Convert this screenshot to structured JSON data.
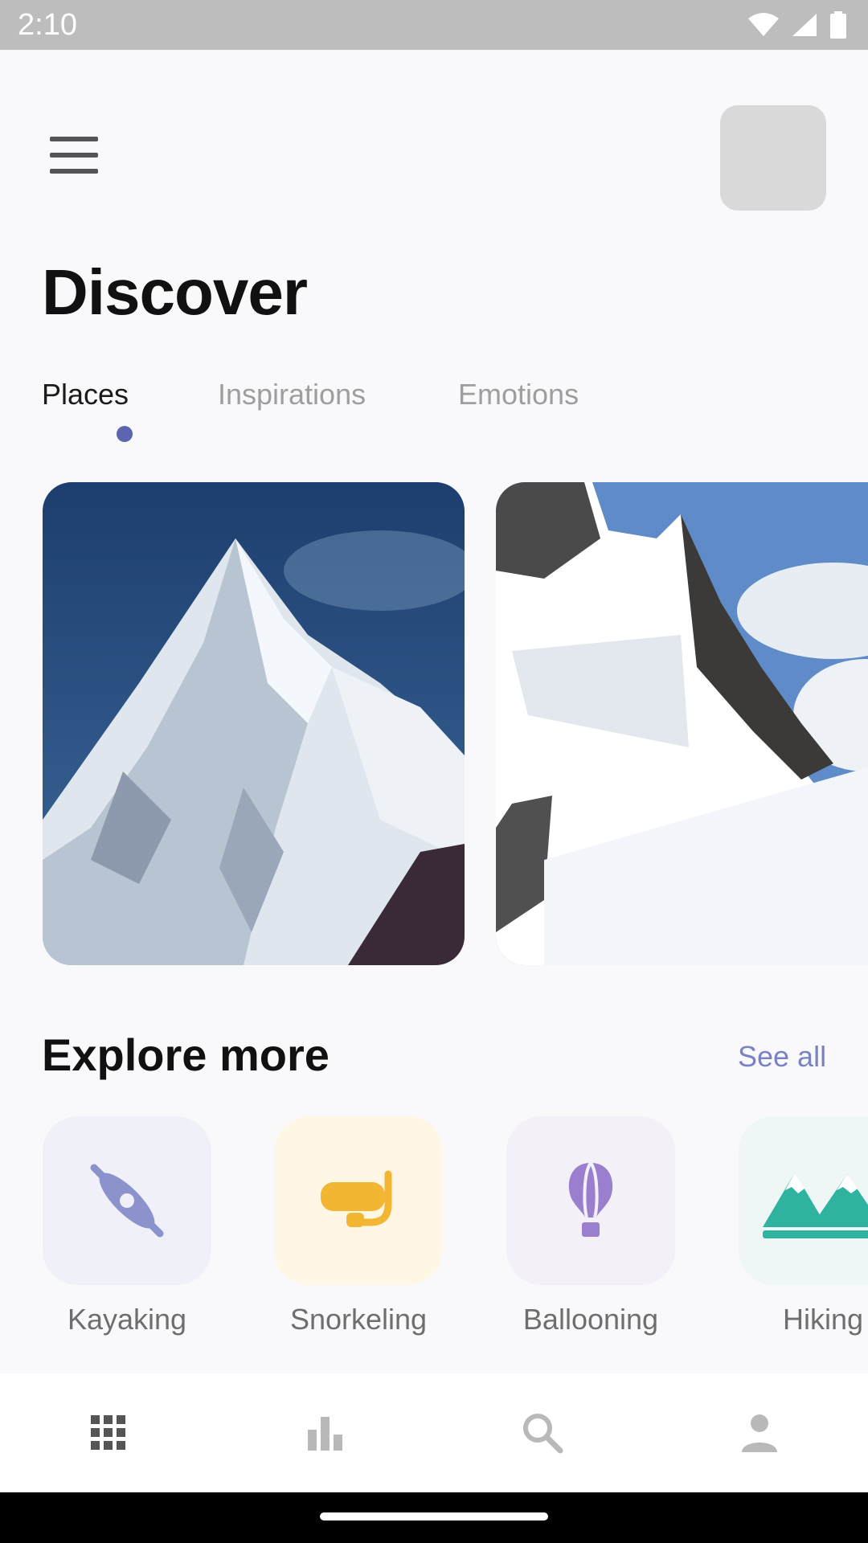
{
  "status_bar": {
    "time": "2:10"
  },
  "header": {
    "title": "Discover"
  },
  "tabs": [
    {
      "label": "Places",
      "active": true
    },
    {
      "label": "Inspirations",
      "active": false
    },
    {
      "label": "Emotions",
      "active": false
    }
  ],
  "explore": {
    "title": "Explore more",
    "see_all": "See all",
    "activities": [
      {
        "label": "Kayaking",
        "icon": "kayak-icon",
        "color": "#8c92cc",
        "bg": "#eff0f8"
      },
      {
        "label": "Snorkeling",
        "icon": "snorkel-mask-icon",
        "color": "#f2b632",
        "bg": "#fff7e6"
      },
      {
        "label": "Ballooning",
        "icon": "hot-air-balloon-icon",
        "color": "#9b7fcf",
        "bg": "#f3f0f8"
      },
      {
        "label": "Hiking",
        "icon": "mountains-icon",
        "color": "#2fb3a0",
        "bg": "#eef7f6"
      }
    ]
  },
  "bottom_nav": [
    {
      "icon": "grid-icon",
      "active": true
    },
    {
      "icon": "bar-chart-icon",
      "active": false
    },
    {
      "icon": "search-icon",
      "active": false
    },
    {
      "icon": "profile-icon",
      "active": false
    }
  ],
  "colors": {
    "accent": "#5c65b0",
    "link": "#7b82c4",
    "background": "#f9f9fb"
  }
}
